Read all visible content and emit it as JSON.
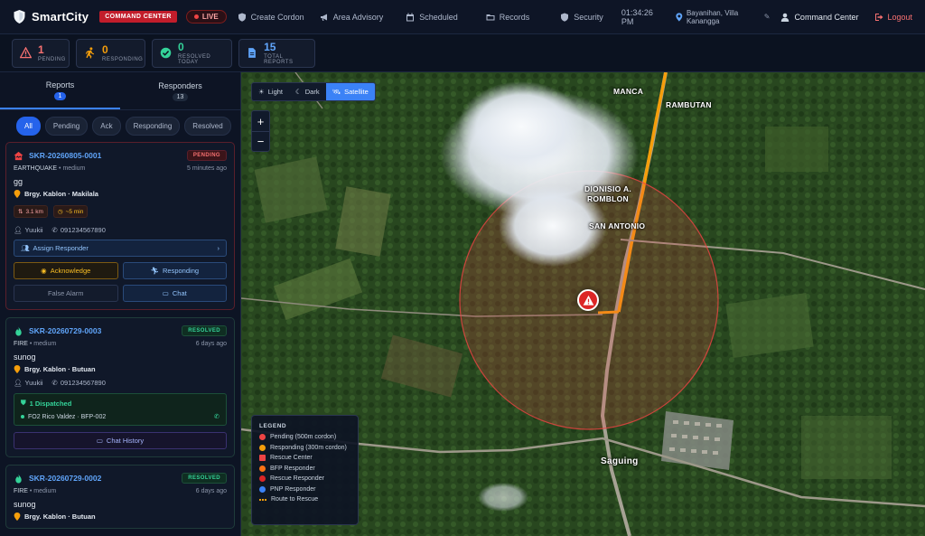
{
  "brand": {
    "name": "SmartCity",
    "command_badge": "COMMAND CENTER",
    "live_label": "LIVE"
  },
  "nav": {
    "items": [
      {
        "label": "Create Cordon",
        "icon": "shield-icon"
      },
      {
        "label": "Area Advisory",
        "icon": "megaphone-icon"
      },
      {
        "label": "Scheduled",
        "icon": "calendar-icon"
      },
      {
        "label": "Records",
        "icon": "folder-icon"
      },
      {
        "label": "Security",
        "icon": "shield-icon"
      }
    ],
    "clock": "01:34:26 PM",
    "location": "Bayanihan, Villa Kanangga",
    "user": "Command Center",
    "logout": "Logout"
  },
  "stats": {
    "pending": {
      "value": "1",
      "label": "PENDING"
    },
    "responding": {
      "value": "0",
      "label": "RESPONDING"
    },
    "resolved": {
      "value": "0",
      "label": "RESOLVED TODAY"
    },
    "total": {
      "value": "15",
      "label": "TOTAL REPORTS"
    }
  },
  "panel": {
    "tabs": {
      "reports": {
        "label": "Reports",
        "count": "1"
      },
      "responders": {
        "label": "Responders",
        "count": "13"
      }
    },
    "filters": [
      "All",
      "Pending",
      "Ack",
      "Responding",
      "Resolved"
    ]
  },
  "reports": [
    {
      "code": "SKR-20260805-0001",
      "status": "PENDING",
      "type": "EARTHQUAKE",
      "severity": "medium",
      "time": "5 minutes ago",
      "desc": "gg",
      "place": "Brgy. Kablon · Makilala",
      "distance": "3.1 km",
      "eta": "~5 min",
      "reporter": "Yuukii",
      "phone": "091234567890",
      "assign_label": "Assign Responder",
      "ack_label": "Acknowledge",
      "responding_label": "Responding",
      "false_label": "False Alarm",
      "chat_label": "Chat"
    },
    {
      "code": "SKR-20260729-0003",
      "status": "RESOLVED",
      "type": "FIRE",
      "severity": "medium",
      "time": "6 days ago",
      "desc": "sunog",
      "place": "Brgy. Kablon · Butuan",
      "reporter": "Yuukii",
      "phone": "091234567890",
      "dispatched_label": "1 Dispatched",
      "dispatched_unit": "FO2 Rico Valdez · BFP-002",
      "chat_history_label": "Chat History"
    },
    {
      "code": "SKR-20260729-0002",
      "status": "RESOLVED",
      "type": "FIRE",
      "severity": "medium",
      "time": "6 days ago",
      "desc": "sunog",
      "place": "Brgy. Kablon · Butuan"
    }
  ],
  "map": {
    "layers": [
      "Light",
      "Dark",
      "Satellite"
    ],
    "active_layer": "Satellite",
    "labels": [
      "MANCA",
      "RAMBUTAN",
      "DIONISIO A. ROMBLON",
      "SAN ANTONIO",
      "Saguing"
    ],
    "legend": {
      "title": "LEGEND",
      "items": [
        {
          "label": "Pending (500m cordon)",
          "color": "#ef4444",
          "shape": "circle"
        },
        {
          "label": "Responding (300m cordon)",
          "color": "#f59e0b",
          "shape": "circle"
        },
        {
          "label": "Rescue Center",
          "color": "#ef4444",
          "shape": "square"
        },
        {
          "label": "BFP Responder",
          "color": "#f97316",
          "shape": "circle"
        },
        {
          "label": "Rescue Responder",
          "color": "#dc2626",
          "shape": "circle"
        },
        {
          "label": "PNP Responder",
          "color": "#3b82f6",
          "shape": "circle"
        },
        {
          "label": "Route to Rescue",
          "color": "#f59e0b",
          "shape": "dash"
        }
      ]
    }
  }
}
